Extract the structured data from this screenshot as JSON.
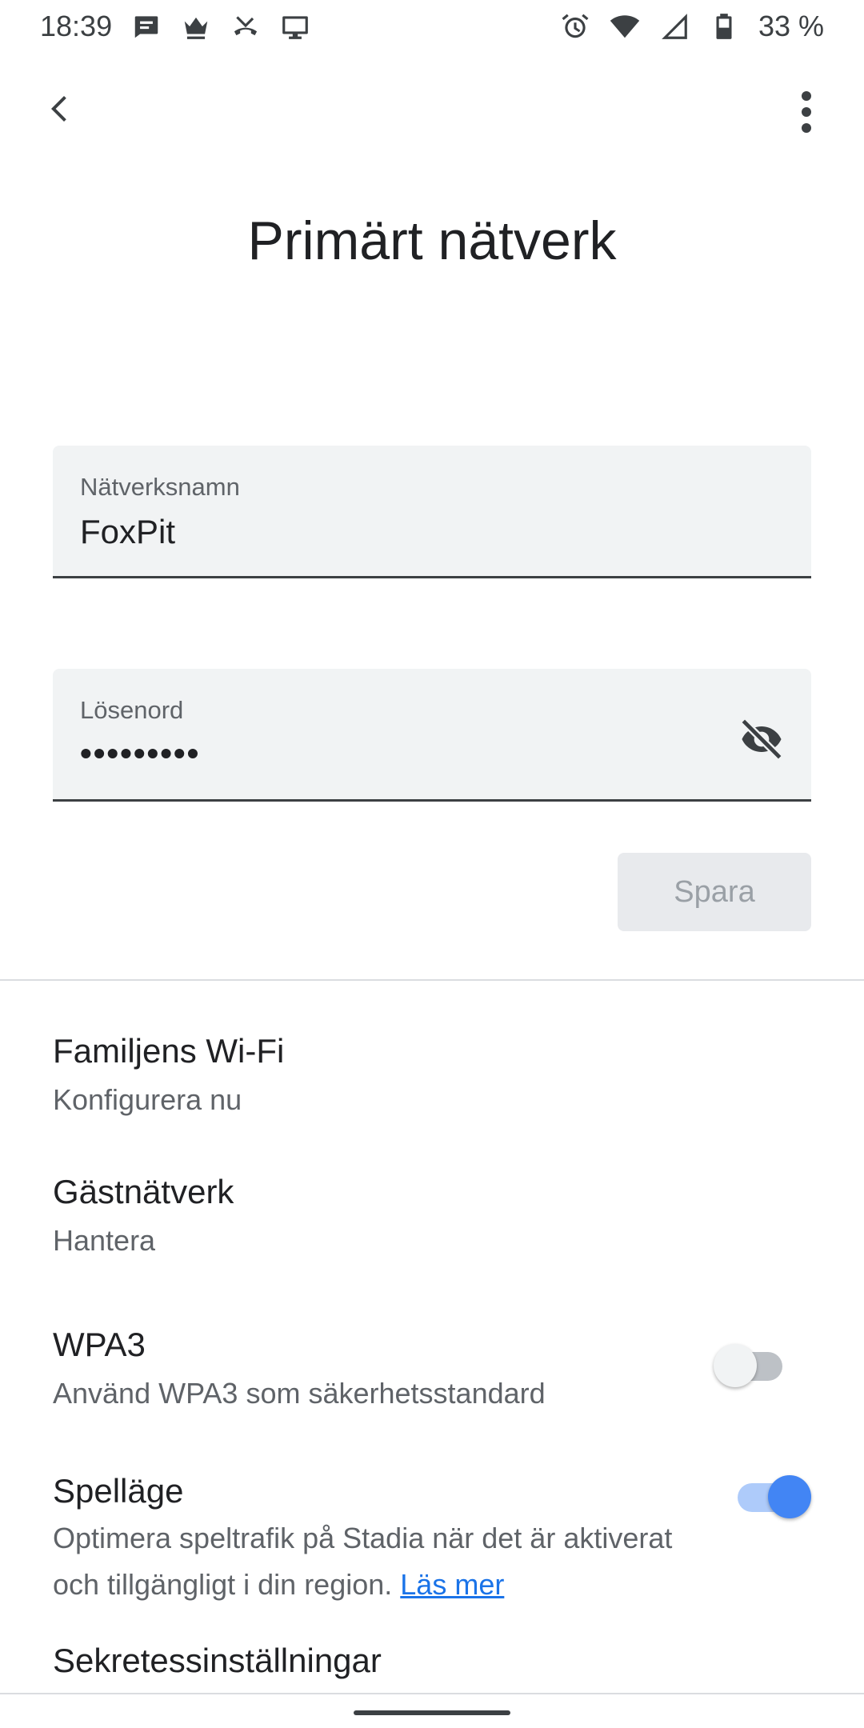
{
  "status_bar": {
    "time": "18:39",
    "left_icons": [
      "message-icon",
      "crown-icon",
      "missed-call-icon",
      "cast-icon"
    ],
    "right_icons": [
      "alarm-icon",
      "wifi-icon",
      "signal-icon",
      "battery-icon"
    ],
    "battery": "33 %"
  },
  "header": {
    "back_icon": "chevron-left-icon",
    "more_icon": "more-vert-icon"
  },
  "page": {
    "title": "Primärt nätverk"
  },
  "form": {
    "network_name": {
      "label": "Nätverksnamn",
      "value": "FoxPit"
    },
    "password": {
      "label": "Lösenord",
      "value": "•••••••••",
      "visibility_icon": "visibility-off-icon"
    },
    "save_label": "Spara",
    "save_enabled": false
  },
  "settings": [
    {
      "title": "Familjens Wi-Fi",
      "subtitle": "Konfigurera nu"
    },
    {
      "title": "Gästnätverk",
      "subtitle": "Hantera"
    },
    {
      "title": "WPA3",
      "subtitle": "Använd WPA3 som säkerhetsstandard",
      "toggle": false
    },
    {
      "title": "Spelläge",
      "subtitle": "Optimera speltrafik på Stadia när det är aktiverat och tillgängligt i din region.",
      "link": "Läs mer",
      "toggle": true
    },
    {
      "title": "Sekretessinställningar"
    }
  ],
  "colors": {
    "accent": "#4285f4",
    "link": "#1a73e8",
    "field_bg": "#f1f3f4"
  }
}
